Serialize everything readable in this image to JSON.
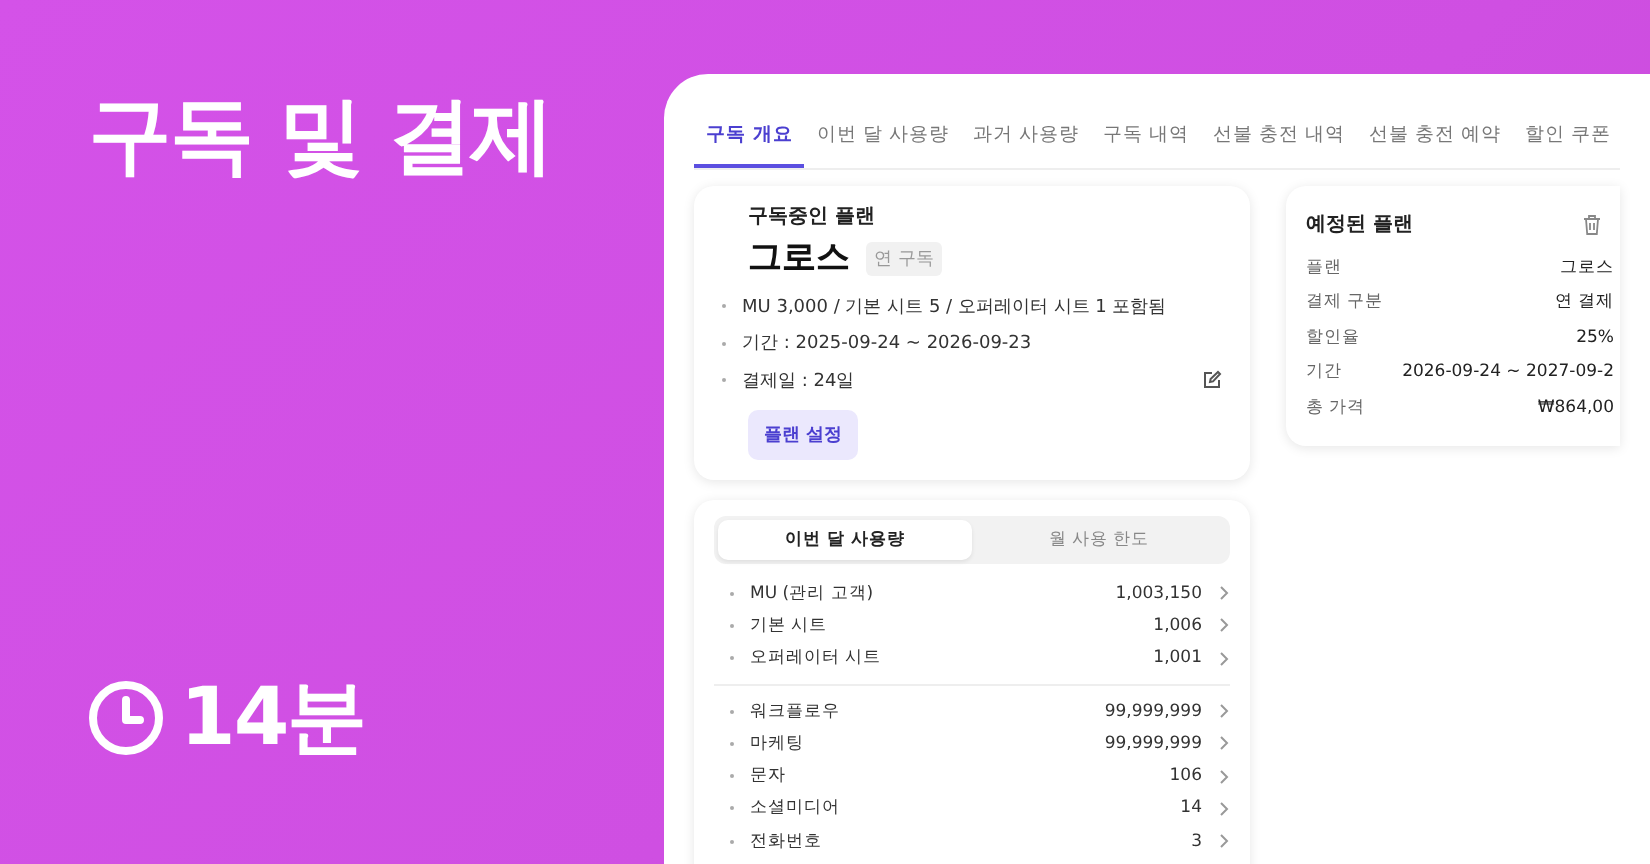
{
  "hero": {
    "title": "구독 및 결제",
    "duration": "14분"
  },
  "tabs": [
    {
      "label": "구독 개요",
      "selected": true
    },
    {
      "label": "이번 달 사용량",
      "selected": false
    },
    {
      "label": "과거 사용량",
      "selected": false
    },
    {
      "label": "구독 내역",
      "selected": false
    },
    {
      "label": "선불 충전 내역",
      "selected": false
    },
    {
      "label": "선불 충전 예약",
      "selected": false
    },
    {
      "label": "할인 쿠폰",
      "selected": false
    }
  ],
  "current_plan": {
    "heading": "구독중인 플랜",
    "name": "그로스",
    "badge": "연 구독",
    "details": [
      "MU 3,000 / 기본 시트 5 / 오퍼레이터 시트 1 포함됨",
      "기간 : 2025-09-24 ~ 2026-09-23",
      "결제일 : 24일"
    ],
    "button": "플랜 설정"
  },
  "scheduled_plan": {
    "heading": "예정된 플랜",
    "rows": [
      {
        "label": "플랜",
        "value": "그로스"
      },
      {
        "label": "결제 구분",
        "value": "연 결제"
      },
      {
        "label": "할인율",
        "value": "25%"
      },
      {
        "label": "기간",
        "value": "2026-09-24 ~ 2027-09-2"
      },
      {
        "label": "총 가격",
        "value": "₩864,00"
      }
    ]
  },
  "usage": {
    "segments": [
      {
        "label": "이번 달 사용량",
        "selected": true
      },
      {
        "label": "월 사용 한도",
        "selected": false
      }
    ],
    "groups": [
      [
        {
          "label": "MU (관리 고객)",
          "value": "1,003,150"
        },
        {
          "label": "기본 시트",
          "value": "1,006"
        },
        {
          "label": "오퍼레이터 시트",
          "value": "1,001"
        }
      ],
      [
        {
          "label": "워크플로우",
          "value": "99,999,999"
        },
        {
          "label": "마케팅",
          "value": "99,999,999"
        },
        {
          "label": "문자",
          "value": "106"
        },
        {
          "label": "소셜미디어",
          "value": "14"
        },
        {
          "label": "전화번호",
          "value": "3"
        }
      ]
    ]
  }
}
